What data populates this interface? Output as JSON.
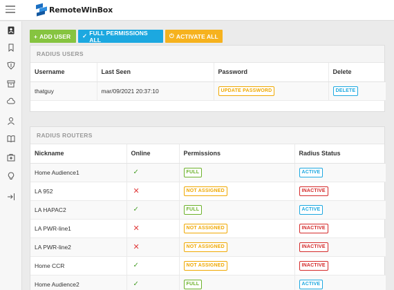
{
  "app": {
    "title": "RemoteWinBox"
  },
  "sidebar": {
    "icons": [
      "contacts-icon",
      "bookmark-icon",
      "shield-icon",
      "archive-icon",
      "cloud-icon",
      "user-icon",
      "book-icon",
      "medkit-icon",
      "lightbulb-icon",
      "logout-icon"
    ]
  },
  "toolbar": {
    "add_user": "ADD USER",
    "full_permissions": "FULL PERMISSIONS ALL",
    "activate_all": "ACTIVATE ALL"
  },
  "users_panel": {
    "title": "RADIUS USERS",
    "columns": [
      "Username",
      "Last Seen",
      "Password",
      "Delete"
    ],
    "rows": [
      {
        "username": "thatguy",
        "last_seen": "mar/09/2021 20:37:10",
        "password_action": "UPDATE PASSWORD",
        "delete_action": "DELETE"
      }
    ]
  },
  "routers_panel": {
    "title": "RADIUS ROUTERS",
    "columns": [
      "Nickname",
      "Online",
      "Permissions",
      "Radius Status"
    ],
    "rows": [
      {
        "nickname": "Home Audience1",
        "online": true,
        "permissions": "FULL",
        "status": "ACTIVE"
      },
      {
        "nickname": "LA 952",
        "online": false,
        "permissions": "NOT ASSIGNED",
        "status": "INACTIVE"
      },
      {
        "nickname": "LA HAPAC2",
        "online": true,
        "permissions": "FULL",
        "status": "ACTIVE"
      },
      {
        "nickname": "LA PWR-line1",
        "online": false,
        "permissions": "NOT ASSIGNED",
        "status": "INACTIVE"
      },
      {
        "nickname": "LA PWR-line2",
        "online": false,
        "permissions": "NOT ASSIGNED",
        "status": "INACTIVE"
      },
      {
        "nickname": "Home CCR",
        "online": true,
        "permissions": "NOT ASSIGNED",
        "status": "INACTIVE"
      },
      {
        "nickname": "Home Audience2",
        "online": true,
        "permissions": "FULL",
        "status": "ACTIVE"
      }
    ]
  },
  "colors": {
    "green": "#86c440",
    "blue": "#1ca8e0",
    "yellow": "#f6b21e",
    "red": "#d42828"
  }
}
